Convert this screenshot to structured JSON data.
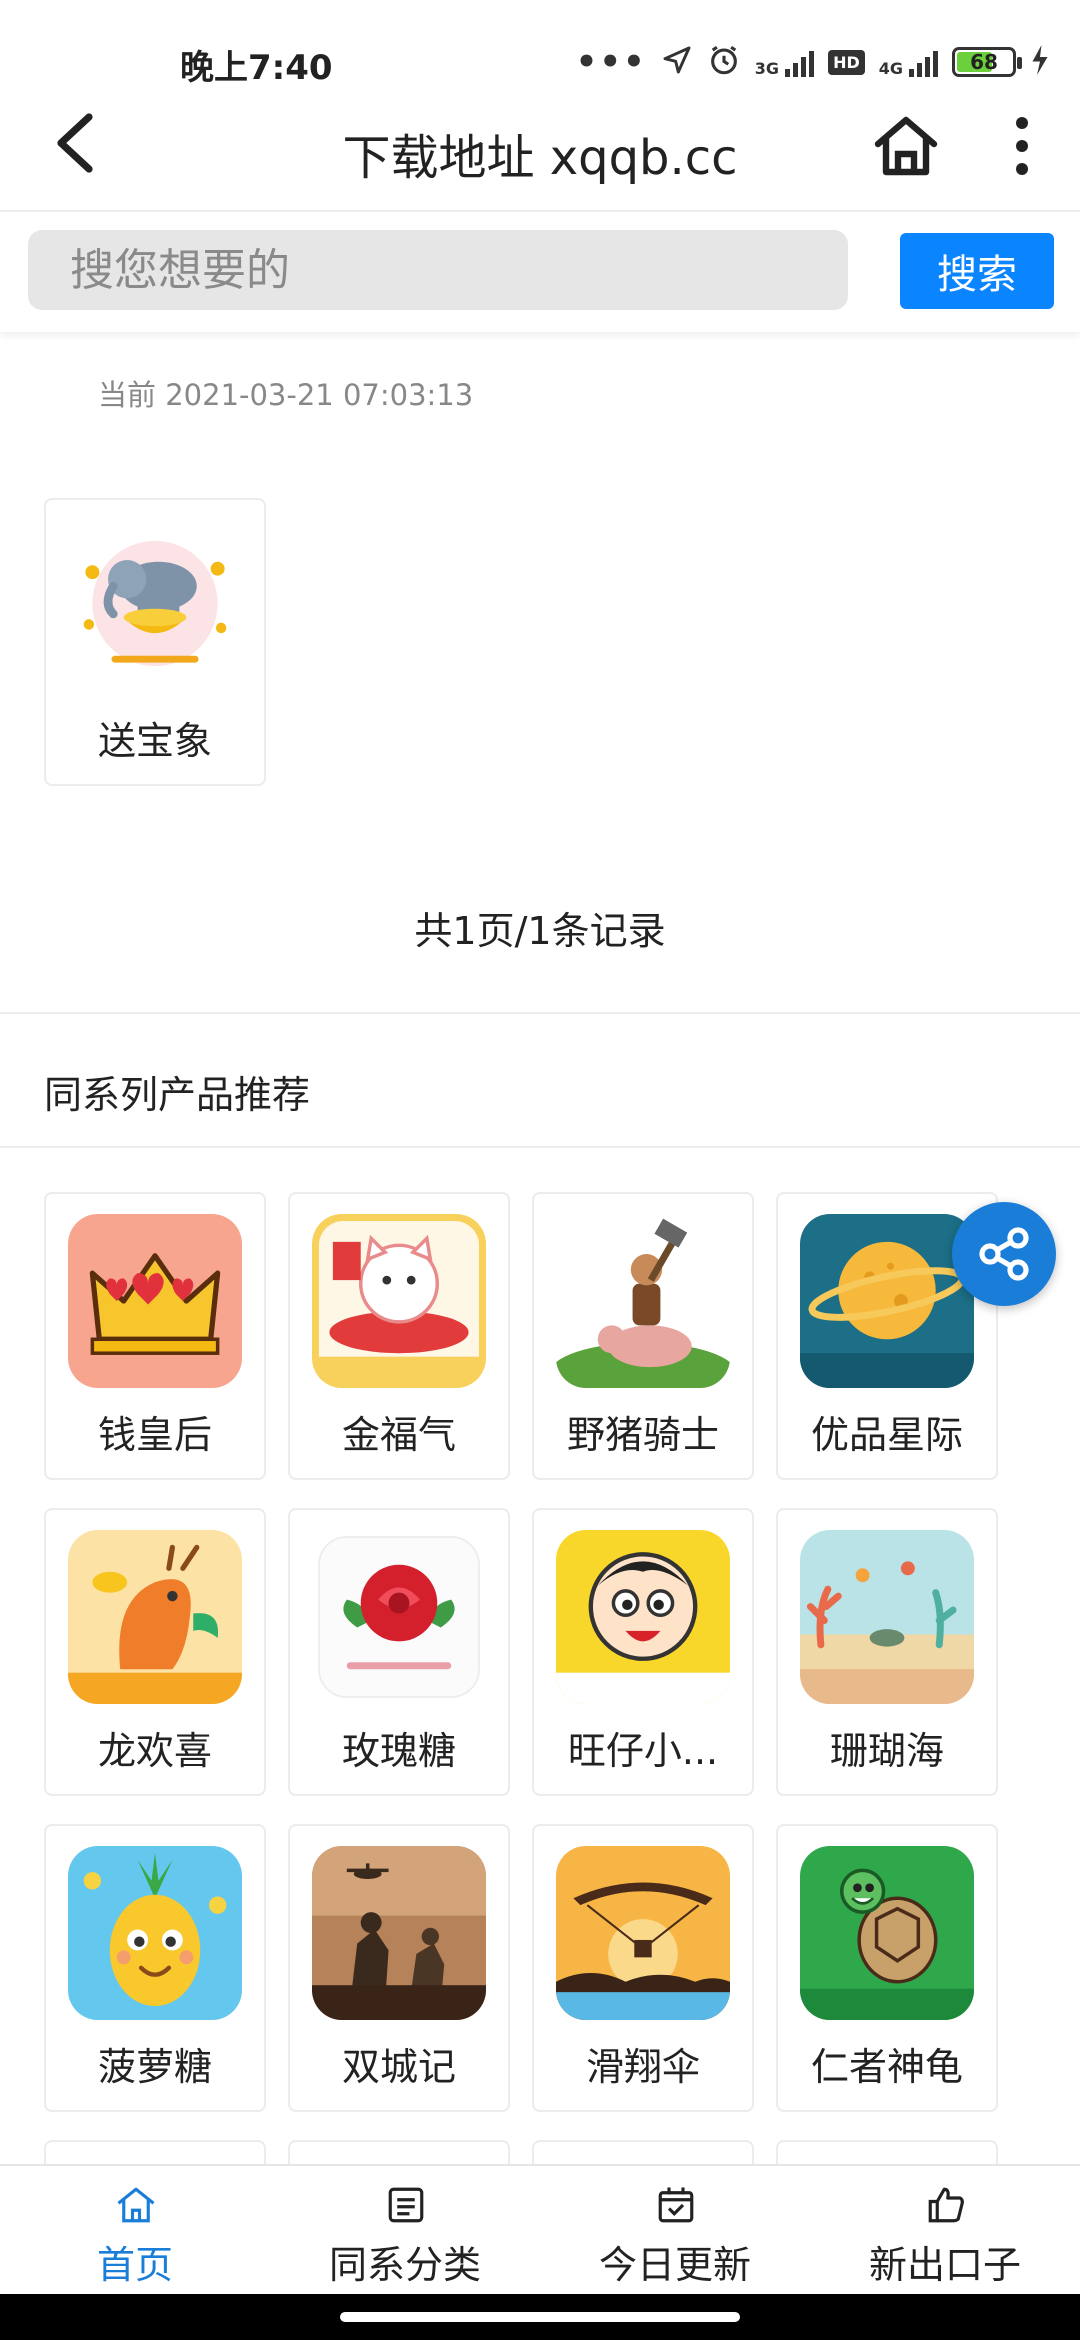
{
  "status_bar": {
    "time": "晚上7:40",
    "dots": "•••",
    "network_3g": "3G",
    "hd": "HD",
    "network_4g": "4G",
    "battery_level": 68,
    "battery_label": "68"
  },
  "header": {
    "title": "下载地址 xqqb.cc"
  },
  "search": {
    "placeholder": "搜您想要的",
    "button_label": "搜索"
  },
  "current_time": "当前 2021-03-21 07:03:13",
  "results": [
    {
      "name": "送宝象",
      "icon": "elephant-icon"
    }
  ],
  "pagination": "共1页/1条记录",
  "recommend": {
    "title": "同系列产品推荐",
    "items": [
      {
        "name": "钱皇后",
        "icon": "crown-icon"
      },
      {
        "name": "金福气",
        "icon": "lucky-cat-icon"
      },
      {
        "name": "野猪骑士",
        "icon": "boar-rider-icon"
      },
      {
        "name": "优品星际",
        "icon": "planet-icon"
      },
      {
        "name": "龙欢喜",
        "icon": "dragon-icon"
      },
      {
        "name": "玫瑰糖",
        "icon": "rose-icon"
      },
      {
        "name": "旺仔小...",
        "icon": "wangzai-icon"
      },
      {
        "name": "珊瑚海",
        "icon": "coral-sea-icon"
      },
      {
        "name": "菠萝糖",
        "icon": "pineapple-icon"
      },
      {
        "name": "双城记",
        "icon": "soldiers-icon"
      },
      {
        "name": "滑翔伞",
        "icon": "paraglider-icon"
      },
      {
        "name": "仁者神龟",
        "icon": "turtle-icon"
      }
    ]
  },
  "bottom_nav": [
    {
      "label": "首页",
      "icon": "home-icon",
      "active": true
    },
    {
      "label": "同系分类",
      "icon": "list-icon",
      "active": false
    },
    {
      "label": "今日更新",
      "icon": "calendar-check-icon",
      "active": false
    },
    {
      "label": "新出口子",
      "icon": "thumbs-up-icon",
      "active": false
    }
  ],
  "colors": {
    "accent": "#1a7ed8",
    "search_button": "#0a84ff"
  }
}
